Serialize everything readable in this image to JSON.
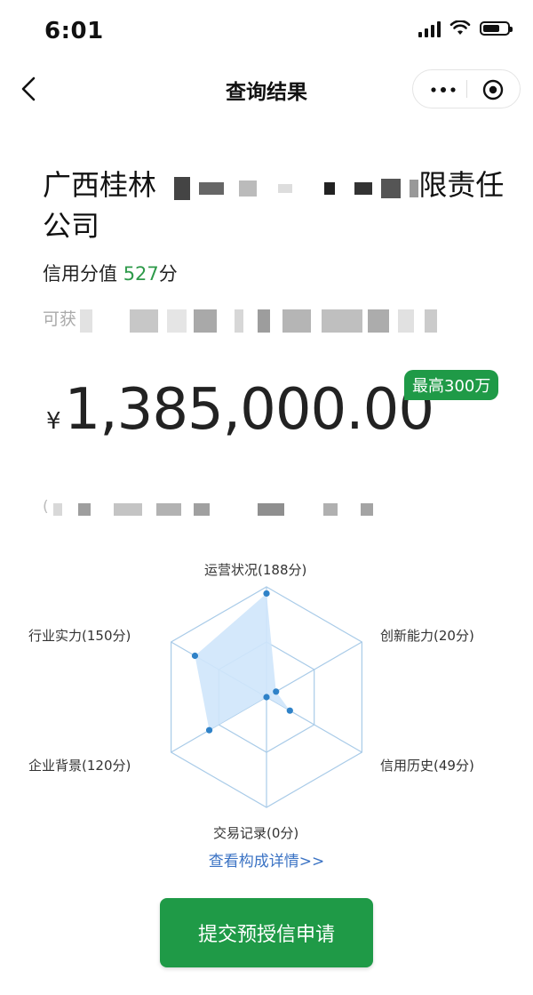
{
  "status_bar": {
    "time": "6:01",
    "icons": [
      "signal-icon",
      "wifi-icon",
      "battery-icon"
    ]
  },
  "nav": {
    "title": "查询结果",
    "back_icon": "chevron-left-icon",
    "more_icon": "more-dots-icon",
    "target_icon": "target-icon"
  },
  "company": {
    "prefix": "广西桂林",
    "suffix": "限责任公司"
  },
  "score": {
    "label": "信用分值 ",
    "value": "527",
    "unit": "分"
  },
  "available": {
    "label": "可获"
  },
  "amount": {
    "currency": "¥",
    "value": "1,385,000.00",
    "badge": "最高300万"
  },
  "note": {
    "prefix": "("
  },
  "radar": {
    "max": 200,
    "axes": [
      {
        "label": "运营状况(188分)",
        "value": 188
      },
      {
        "label": "创新能力(20分)",
        "value": 20
      },
      {
        "label": "信用历史(49分)",
        "value": 49
      },
      {
        "label": "交易记录(0分)",
        "value": 0
      },
      {
        "label": "企业背景(120分)",
        "value": 120
      },
      {
        "label": "行业实力(150分)",
        "value": 150
      }
    ],
    "fill_color": "#cfe5fb",
    "point_color": "#2f82c8",
    "grid_color": "#a9cbe8"
  },
  "detail_link": "查看构成详情>>",
  "submit_button": "提交预授信申请",
  "colors": {
    "accent_green": "#1f9a47",
    "score_green": "#2e9a4a",
    "link_blue": "#3b73c4"
  }
}
